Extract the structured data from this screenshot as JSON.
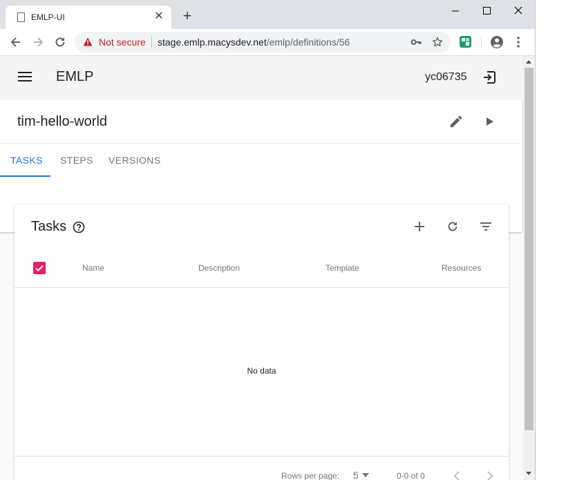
{
  "browser": {
    "tab_title": "EMLP-UI",
    "security_label": "Not secure",
    "url_host": "stage.emlp.macysdev.net",
    "url_path": "/emlp/definitions/56"
  },
  "app": {
    "brand": "EMLP",
    "user": "yc06735"
  },
  "definition": {
    "title": "tim-hello-world",
    "tabs": [
      "TASKS",
      "STEPS",
      "VERSIONS"
    ],
    "active_tab": "TASKS"
  },
  "tasks_table": {
    "title": "Tasks",
    "columns": [
      "Name",
      "Description",
      "Template",
      "Resources"
    ],
    "empty_text": "No data",
    "rows_per_page_label": "Rows per page:",
    "rows_per_page_value": "5",
    "range_text": "0-0 of 0"
  },
  "colors": {
    "accent": "#1976d2",
    "checkbox": "#e91e63",
    "warning": "#c5221f"
  }
}
